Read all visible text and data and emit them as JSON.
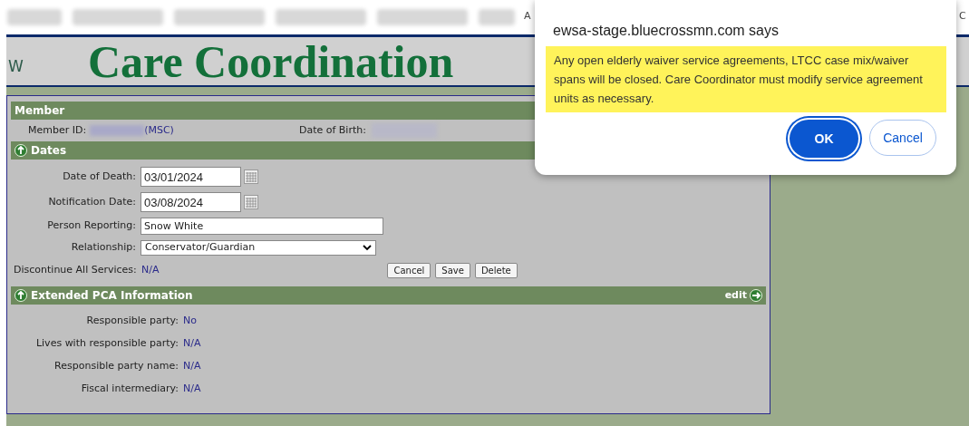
{
  "top_nav": {
    "fragments": [
      "A",
      "C"
    ]
  },
  "header": {
    "logo_fragment": "W",
    "title": "Care Coordination"
  },
  "member_section": {
    "title": "Member",
    "member_id_label": "Member ID:",
    "member_id_suffix": "(MSC)",
    "dob_label": "Date of Birth:"
  },
  "dates_section": {
    "title": "Dates",
    "expanded": true,
    "fields": [
      {
        "kind": "date",
        "label": "Date of Death:",
        "value": "03/01/2024"
      },
      {
        "kind": "date",
        "label": "Notification Date:",
        "value": "03/08/2024"
      },
      {
        "kind": "text",
        "label": "Person Reporting:",
        "value": "Snow White"
      },
      {
        "kind": "select",
        "label": "Relationship:",
        "value": "Conservator/Guardian"
      }
    ],
    "discontinue": {
      "label": "Discontinue All Services:",
      "value": "N/A"
    },
    "buttons": [
      "Cancel",
      "Save",
      "Delete"
    ]
  },
  "pca_section": {
    "title": "Extended PCA Information",
    "expanded": true,
    "edit_link": "edit",
    "rows": [
      {
        "label": "Responsible party:",
        "value": "No"
      },
      {
        "label": "Lives with responsible party:",
        "value": "N/A"
      },
      {
        "label": "Responsible party name:",
        "value": "N/A"
      },
      {
        "label": "Fiscal intermediary:",
        "value": "N/A"
      }
    ]
  },
  "dialog": {
    "title": "ewsa-stage.bluecrossmn.com says",
    "message": "Any open elderly waiver service agreements, LTCC case mix/waiver spans will be closed. Care Coordinator must modify service agreement units as necessary.",
    "buttons": [
      {
        "label": "OK",
        "primary": true
      },
      {
        "label": "Cancel",
        "primary": false
      }
    ]
  }
}
